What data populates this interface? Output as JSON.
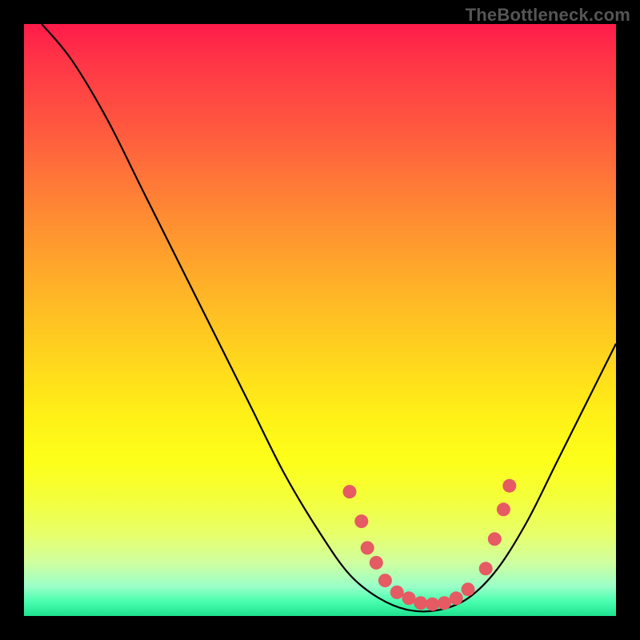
{
  "watermark": "TheBottleneck.com",
  "chart_data": {
    "type": "line",
    "title": "",
    "xlabel": "",
    "ylabel": "",
    "xlim": [
      0,
      100
    ],
    "ylim": [
      0,
      100
    ],
    "grid": false,
    "legend": false,
    "curve": [
      {
        "x": 3,
        "y": 100
      },
      {
        "x": 8,
        "y": 94
      },
      {
        "x": 14,
        "y": 84
      },
      {
        "x": 20,
        "y": 72
      },
      {
        "x": 26,
        "y": 60
      },
      {
        "x": 32,
        "y": 48
      },
      {
        "x": 38,
        "y": 36
      },
      {
        "x": 44,
        "y": 24
      },
      {
        "x": 50,
        "y": 14
      },
      {
        "x": 55,
        "y": 7
      },
      {
        "x": 60,
        "y": 3
      },
      {
        "x": 65,
        "y": 1
      },
      {
        "x": 70,
        "y": 1
      },
      {
        "x": 75,
        "y": 3
      },
      {
        "x": 80,
        "y": 8
      },
      {
        "x": 85,
        "y": 16
      },
      {
        "x": 90,
        "y": 26
      },
      {
        "x": 95,
        "y": 36
      },
      {
        "x": 100,
        "y": 46
      }
    ],
    "markers": [
      {
        "x": 55,
        "y": 21
      },
      {
        "x": 57,
        "y": 16
      },
      {
        "x": 58,
        "y": 11.5
      },
      {
        "x": 59.5,
        "y": 9
      },
      {
        "x": 61,
        "y": 6
      },
      {
        "x": 63,
        "y": 4
      },
      {
        "x": 65,
        "y": 3
      },
      {
        "x": 67,
        "y": 2.2
      },
      {
        "x": 69,
        "y": 2
      },
      {
        "x": 71,
        "y": 2.2
      },
      {
        "x": 73,
        "y": 3
      },
      {
        "x": 75,
        "y": 4.5
      },
      {
        "x": 78,
        "y": 8
      },
      {
        "x": 79.5,
        "y": 13
      },
      {
        "x": 81,
        "y": 18
      },
      {
        "x": 82,
        "y": 22
      }
    ],
    "marker_color": "#e65a63",
    "curve_color": "#000000"
  }
}
